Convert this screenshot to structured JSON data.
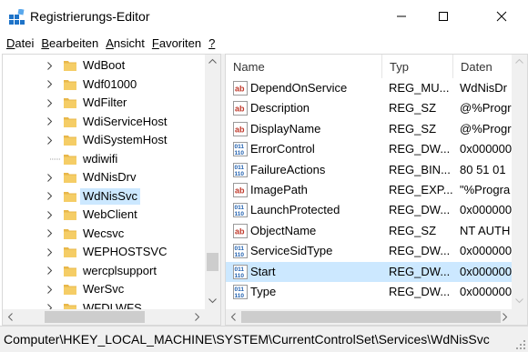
{
  "window": {
    "title": "Registrierungs-Editor"
  },
  "menu": [
    {
      "acc": "D",
      "rest": "atei"
    },
    {
      "acc": "B",
      "rest": "earbeiten"
    },
    {
      "acc": "A",
      "rest": "nsicht"
    },
    {
      "acc": "F",
      "rest": "avoriten"
    },
    {
      "acc": "?",
      "rest": ""
    }
  ],
  "tree": {
    "items": [
      {
        "label": "WdBoot",
        "expandable": true,
        "selected": false
      },
      {
        "label": "Wdf01000",
        "expandable": true,
        "selected": false
      },
      {
        "label": "WdFilter",
        "expandable": true,
        "selected": false
      },
      {
        "label": "WdiServiceHost",
        "expandable": true,
        "selected": false
      },
      {
        "label": "WdiSystemHost",
        "expandable": true,
        "selected": false
      },
      {
        "label": "wdiwifi",
        "expandable": false,
        "selected": false
      },
      {
        "label": "WdNisDrv",
        "expandable": true,
        "selected": false
      },
      {
        "label": "WdNisSvc",
        "expandable": true,
        "selected": true
      },
      {
        "label": "WebClient",
        "expandable": true,
        "selected": false
      },
      {
        "label": "Wecsvc",
        "expandable": true,
        "selected": false
      },
      {
        "label": "WEPHOSTSVC",
        "expandable": true,
        "selected": false
      },
      {
        "label": "wercplsupport",
        "expandable": true,
        "selected": false
      },
      {
        "label": "WerSvc",
        "expandable": true,
        "selected": false
      },
      {
        "label": "WFDLWFS",
        "expandable": true,
        "selected": false
      }
    ]
  },
  "list": {
    "columns": [
      "Name",
      "Typ",
      "Daten"
    ],
    "rows": [
      {
        "icon": "string-value-icon",
        "name": "DependOnService",
        "type": "REG_MU...",
        "data": "WdNisDr",
        "selected": false
      },
      {
        "icon": "string-value-icon",
        "name": "Description",
        "type": "REG_SZ",
        "data": "@%Progr",
        "selected": false
      },
      {
        "icon": "string-value-icon",
        "name": "DisplayName",
        "type": "REG_SZ",
        "data": "@%Progr",
        "selected": false
      },
      {
        "icon": "binary-value-icon",
        "name": "ErrorControl",
        "type": "REG_DW...",
        "data": "0x000000",
        "selected": false
      },
      {
        "icon": "binary-value-icon",
        "name": "FailureActions",
        "type": "REG_BIN...",
        "data": "80 51 01",
        "selected": false
      },
      {
        "icon": "string-value-icon",
        "name": "ImagePath",
        "type": "REG_EXP...",
        "data": "\"%Progra",
        "selected": false
      },
      {
        "icon": "binary-value-icon",
        "name": "LaunchProtected",
        "type": "REG_DW...",
        "data": "0x000000",
        "selected": false
      },
      {
        "icon": "string-value-icon",
        "name": "ObjectName",
        "type": "REG_SZ",
        "data": "NT AUTH",
        "selected": false
      },
      {
        "icon": "binary-value-icon",
        "name": "ServiceSidType",
        "type": "REG_DW...",
        "data": "0x000000",
        "selected": false
      },
      {
        "icon": "binary-value-icon",
        "name": "Start",
        "type": "REG_DW...",
        "data": "0x000000",
        "selected": true
      },
      {
        "icon": "binary-value-icon",
        "name": "Type",
        "type": "REG_DW...",
        "data": "0x000000",
        "selected": false
      }
    ]
  },
  "status": {
    "path": "Computer\\HKEY_LOCAL_MACHINE\\SYSTEM\\CurrentControlSet\\Services\\WdNisSvc"
  },
  "colors": {
    "selection": "#cce8ff",
    "folder": "#e8b74a",
    "string_icon": "#c0392b",
    "binary_icon": "#1f5fae"
  }
}
